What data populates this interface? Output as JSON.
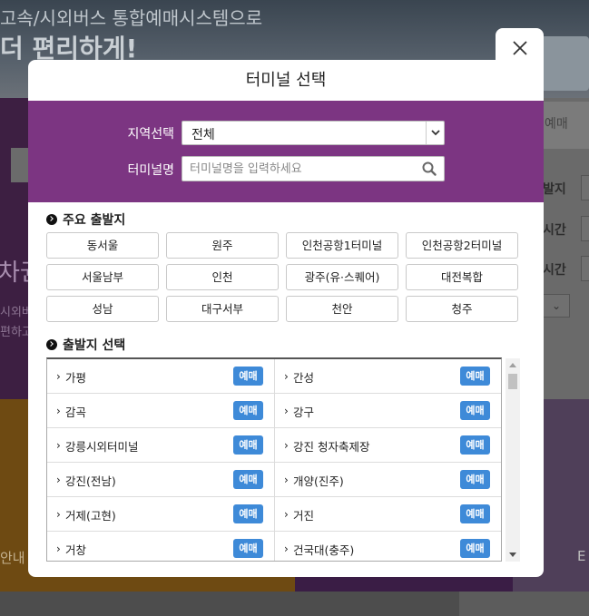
{
  "background": {
    "banner_line1": "고속/시외버스 통합예매시스템으로",
    "banner_line2": "더 편리하게!",
    "left_big_text": "차권",
    "left_small_line1": "시외버",
    "left_small_line2": "편하고",
    "right_tab": "예매",
    "right_labels": [
      "발지",
      "시간",
      "시간"
    ],
    "bottom_left_text": "안내",
    "bottom_right_text": "E"
  },
  "modal": {
    "title": "터미널 선택",
    "close_icon": "close-icon"
  },
  "filter": {
    "region_label": "지역선택",
    "region_value": "전체",
    "terminal_label": "터미널명",
    "terminal_placeholder": "터미널명을 입력하세요",
    "search_icon": "search-icon"
  },
  "major": {
    "heading": "주요 출발지",
    "items": [
      "동서울",
      "원주",
      "인천공항1터미널",
      "인천공항2터미널",
      "서울남부",
      "인천",
      "광주(유·스퀘어)",
      "대전복합",
      "성남",
      "대구서부",
      "천안",
      "청주"
    ]
  },
  "departure": {
    "heading": "출발지 선택",
    "book_label": "예매",
    "rows": [
      [
        "가평",
        "간성"
      ],
      [
        "감곡",
        "강구"
      ],
      [
        "강릉시외터미널",
        "강진 청자축제장"
      ],
      [
        "강진(전남)",
        "개양(진주)"
      ],
      [
        "거제(고현)",
        "거진"
      ],
      [
        "거창",
        "건국대(충주)"
      ]
    ]
  },
  "colors": {
    "filter_bg": "#7c3582",
    "book_button": "#3e8ad8"
  }
}
